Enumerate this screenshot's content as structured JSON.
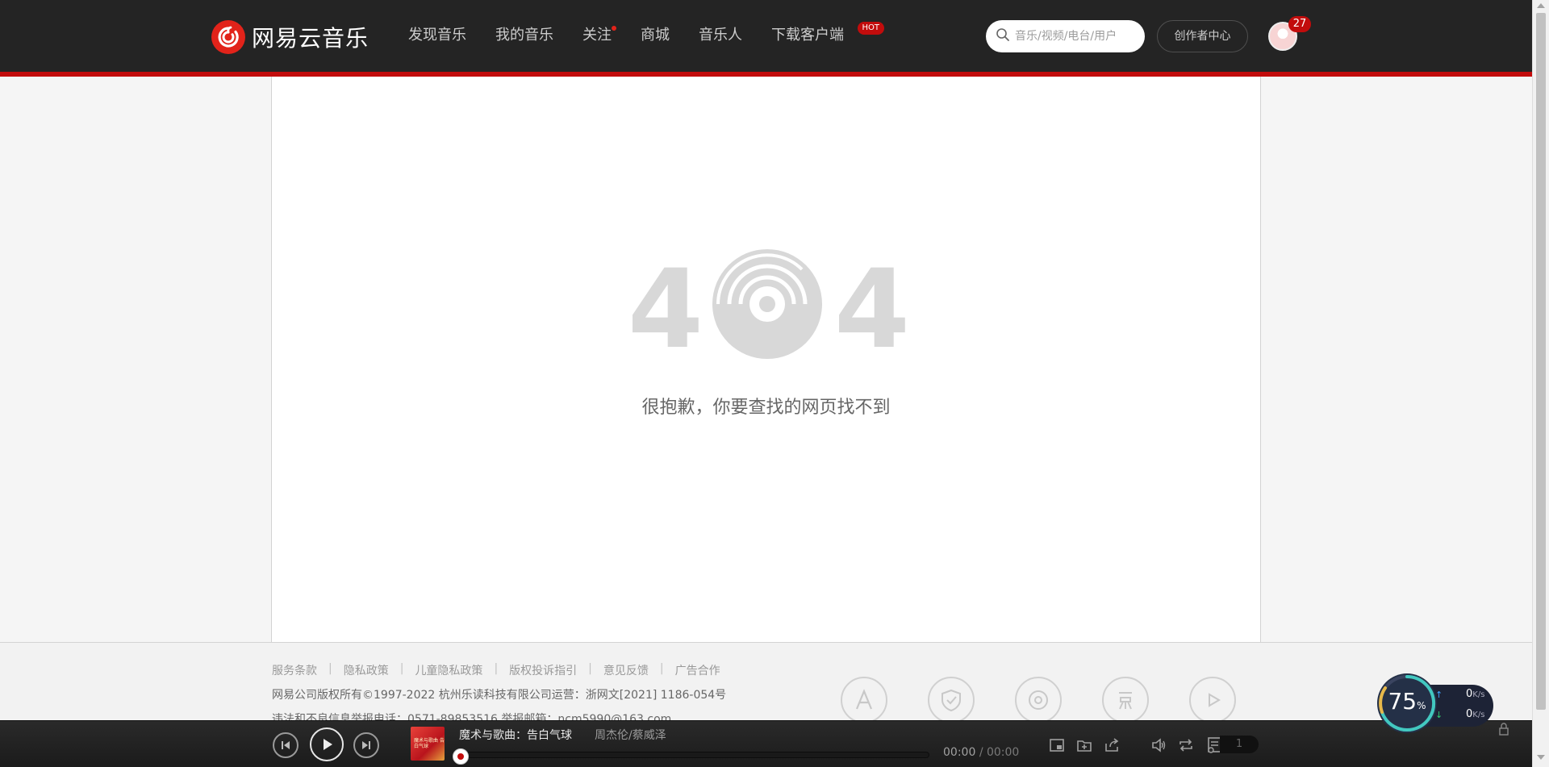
{
  "header": {
    "logo_text": "网易云音乐",
    "nav": [
      {
        "label": "发现音乐"
      },
      {
        "label": "我的音乐"
      },
      {
        "label": "关注"
      },
      {
        "label": "商城"
      },
      {
        "label": "音乐人"
      },
      {
        "label": "下载客户端"
      }
    ],
    "hot_badge": "HOT",
    "search_placeholder": "音乐/视频/电台/用户",
    "creator_button": "创作者中心",
    "message_count": "27",
    "accent_color": "#c20c0c"
  },
  "main": {
    "error_code_left": "4",
    "error_code_right": "4",
    "error_message": "很抱歉，你要查找的网页找不到"
  },
  "footer": {
    "links": [
      "服务条款",
      "隐私政策",
      "儿童隐私政策",
      "版权投诉指引",
      "意见反馈",
      "广告合作"
    ],
    "separator": "|",
    "copyright": "网易公司版权所有©1997-2022    杭州乐读科技有限公司运营：浙网文[2021] 1186-054号",
    "report": "违法和不良信息举报电话：0571-89853516    举报邮箱：ncm5990@163.com"
  },
  "player": {
    "song_title": "魔术与歌曲：告白气球",
    "artist": "周杰伦/蔡威泽",
    "current_time": "00:00",
    "time_separator": "/",
    "total_time": "00:00",
    "playlist_count": "1",
    "cover_text": "魔术与歌曲 告白气球"
  },
  "network_widget": {
    "percent": "75",
    "percent_unit": "%",
    "upload": "0",
    "download": "0",
    "unit": "K/s",
    "up_arrow": "↑",
    "down_arrow": "↓"
  }
}
